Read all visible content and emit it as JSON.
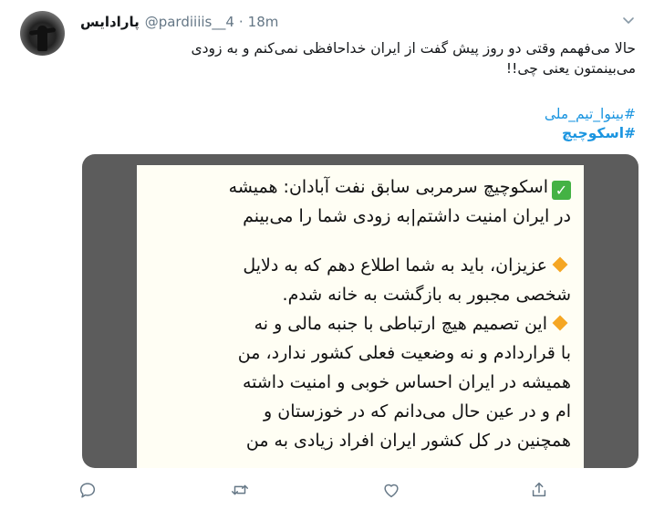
{
  "tweet": {
    "display_name": "پارادایس",
    "handle": "@pardiiiis__4",
    "separator": "·",
    "time": "18m",
    "text_line1": "حالا می‌فهمم وقتی دو روز پیش گفت از ایران خداحافظی نمی‌کنم و به زودی",
    "text_line2": "می‌بینمتون یعنی چی!!",
    "hashtags": [
      "#بینوا_تیم_ملی",
      "#اسکوچیچ"
    ]
  },
  "media": {
    "line1": "اسکوچیچ سرمربی سابق نفت آبادان: همیشه",
    "line2": "در ایران امنیت داشتم|به زودی شما را می‌بینم",
    "line3": "عزیزان، باید به شما اطلاع دهم که به دلایل",
    "line4": "شخصی مجبور به بازگشت به خانه شدم.",
    "line5": "این تصمیم هیچ ارتباطی با جنبه مالی و نه",
    "line6": "با قراردادم و نه وضعیت فعلی کشور ندارد، من",
    "line7": "همیشه در ایران احساس خوبی و امنیت داشته",
    "line8": "ام و در عین حال می‌دانم که در خوزستان و",
    "line9": "همچنین در کل کشور ایران افراد زیادی به من"
  },
  "icons": {
    "reply": "reply-icon",
    "retweet": "retweet-icon",
    "like": "like-icon",
    "share": "share-icon",
    "caret": "chevron-down-icon"
  },
  "colors": {
    "link": "#1b95e0",
    "muted": "#657786",
    "check": "#44b244",
    "diamond": "#f5a623"
  }
}
